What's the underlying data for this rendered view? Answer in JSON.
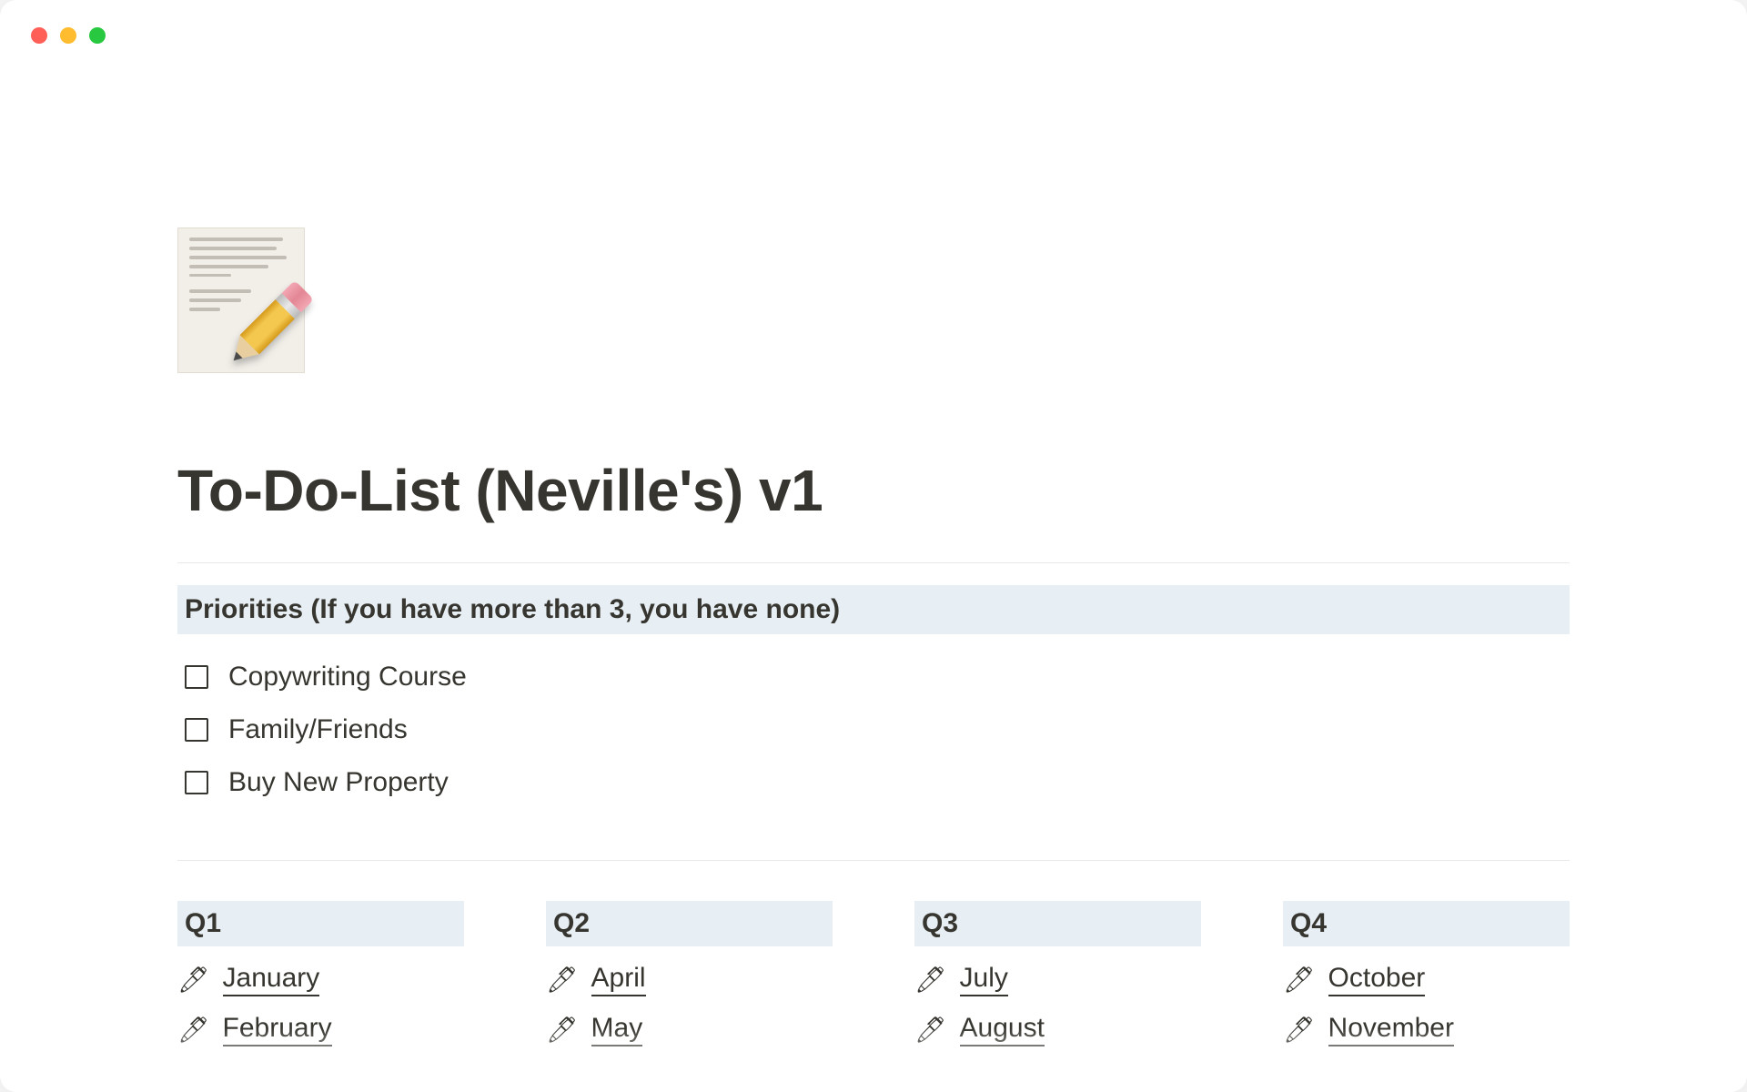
{
  "page": {
    "title": "To-Do-List (Neville's) v1",
    "icon_name": "memo-pencil-icon"
  },
  "priorities": {
    "heading": "Priorities (If you have more than 3, you have none)",
    "items": [
      {
        "label": "Copywriting Course",
        "checked": false
      },
      {
        "label": "Family/Friends",
        "checked": false
      },
      {
        "label": "Buy New Property",
        "checked": false
      }
    ]
  },
  "quarters": [
    {
      "label": "Q1",
      "months": [
        {
          "label": "January"
        },
        {
          "label": "February"
        }
      ]
    },
    {
      "label": "Q2",
      "months": [
        {
          "label": "April"
        },
        {
          "label": "May"
        }
      ]
    },
    {
      "label": "Q3",
      "months": [
        {
          "label": "July"
        },
        {
          "label": "August"
        }
      ]
    },
    {
      "label": "Q4",
      "months": [
        {
          "label": "October"
        },
        {
          "label": "November"
        }
      ]
    }
  ],
  "icons": {
    "pen": "🖊"
  }
}
